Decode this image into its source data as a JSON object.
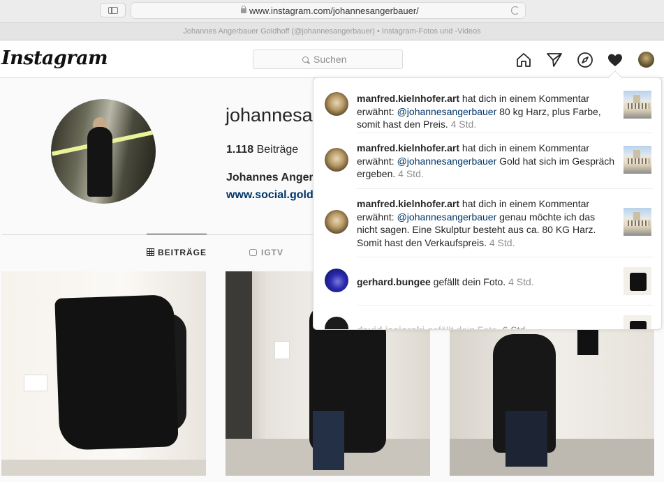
{
  "browser": {
    "url": "www.instagram.com/johannesangerbauer/",
    "page_title": "Johannes Angerbauer Goldhoff (@johannesangerbauer) • Instagram-Fotos und -Videos"
  },
  "header": {
    "logo": "Instagram",
    "search_placeholder": "Suchen",
    "icons": [
      "home-icon",
      "direct-icon",
      "explore-icon",
      "activity-heart-icon",
      "profile-avatar"
    ]
  },
  "profile": {
    "username": "johannesar",
    "posts_count": "1.118",
    "posts_label": "Beiträge",
    "full_name": "Johannes Anger",
    "website": "www.social.gold"
  },
  "tabs": [
    {
      "label": "BEITRÄGE",
      "active": true,
      "icon": "grid-icon"
    },
    {
      "label": "IGTV",
      "active": false,
      "icon": "igtv-icon"
    }
  ],
  "notifications": [
    {
      "user": "manfred.kielnhofer.art",
      "text_before": " hat dich in einem Kommentar erwähnt: ",
      "mention": "@johannesangerbauer",
      "text_after": " 80 kg Harz, plus Farbe, somit hast den Preis. ",
      "time": "4 Std."
    },
    {
      "user": "manfred.kielnhofer.art",
      "text_before": " hat dich in einem Kommentar erwähnt: ",
      "mention": "@johannesangerbauer",
      "text_after": " Gold hat sich im Gespräch ergeben. ",
      "time": "4 Std."
    },
    {
      "user": "manfred.kielnhofer.art",
      "text_before": " hat dich in einem Kommentar erwähnt: ",
      "mention": "@johannesangerbauer",
      "text_after": " genau möchte ich das nicht sagen. Eine Skulptur besteht aus ca. 80 KG Harz. Somit hast den Verkaufspreis. ",
      "time": "4 Std."
    },
    {
      "user": "gerhard.bungee",
      "text_before": " gefällt dein Foto. ",
      "mention": "",
      "text_after": "",
      "time": "4 Std."
    },
    {
      "user": "david.jasiorski",
      "text_before": " gefällt dein Foto. ",
      "mention": "",
      "text_after": "",
      "time": "6 Std."
    }
  ],
  "colors": {
    "accent_link": "#003569",
    "muted": "#8e8e8e",
    "border": "#dbdbdb"
  }
}
